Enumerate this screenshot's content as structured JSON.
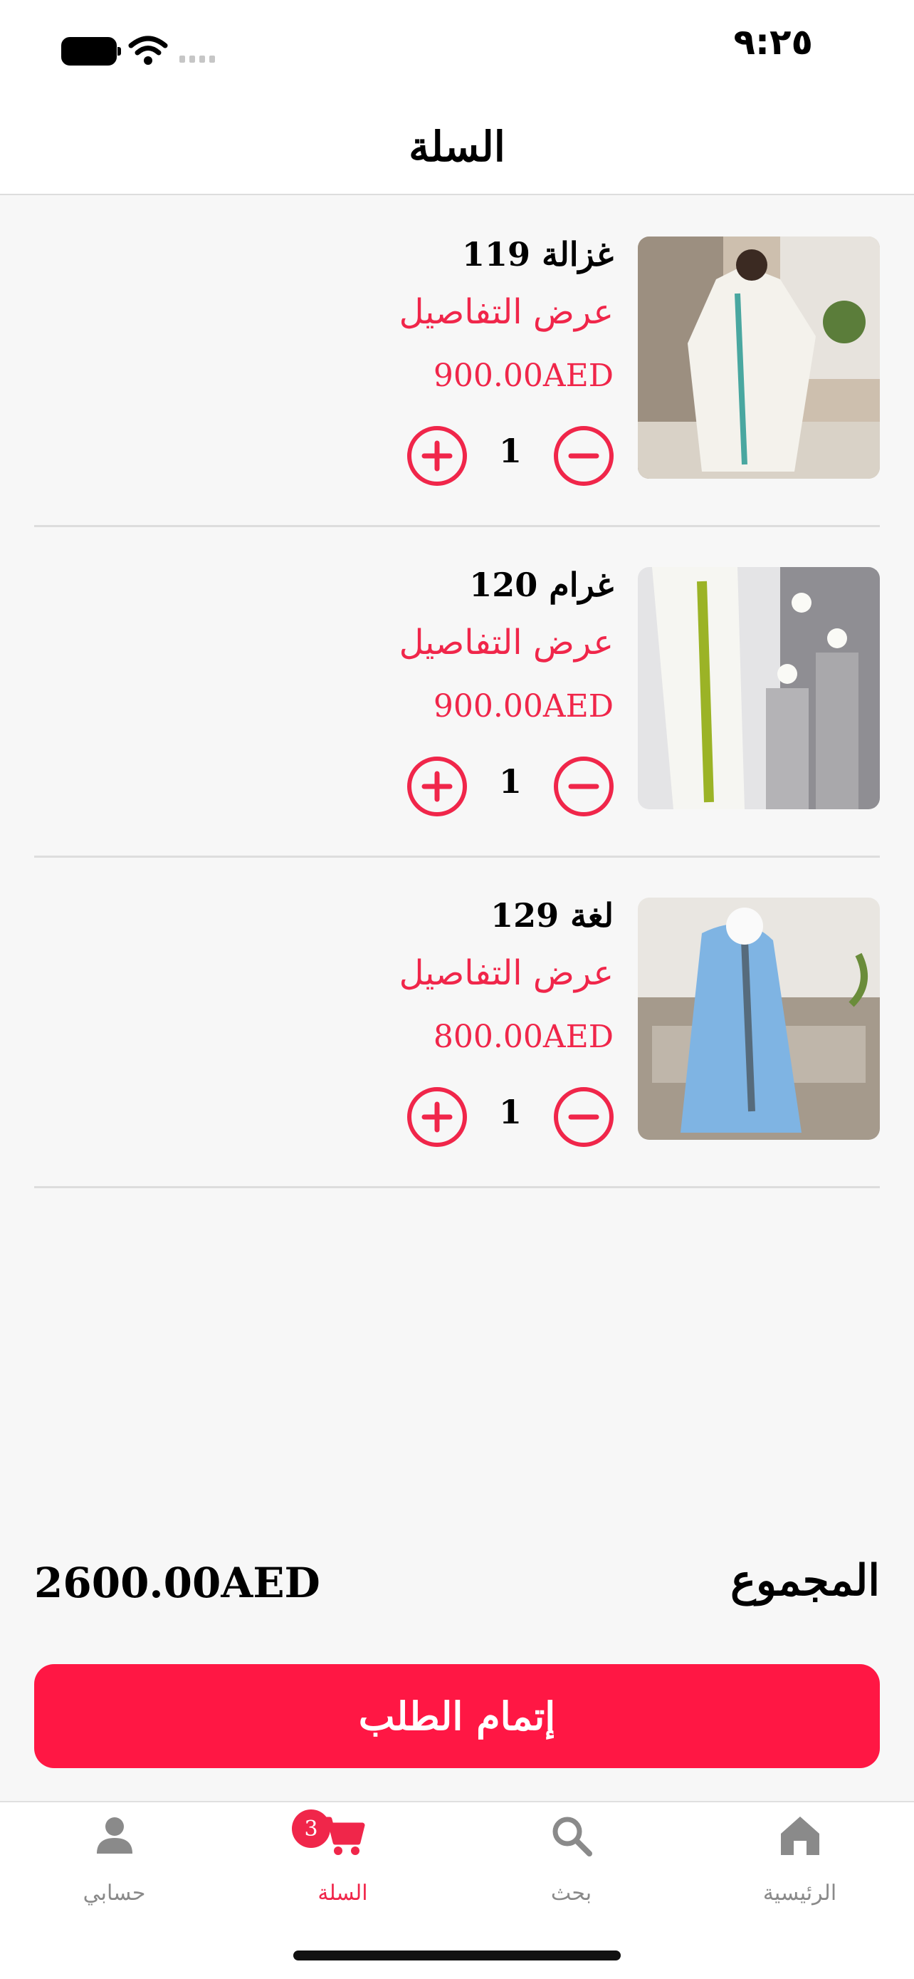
{
  "status": {
    "time": "٩:٢٥"
  },
  "header": {
    "title": "السلة"
  },
  "cart": {
    "items": [
      {
        "name": "غزالة 119",
        "details_label": "عرض التفاصيل",
        "price": "900.00AED",
        "quantity": "1"
      },
      {
        "name": "غرام 120",
        "details_label": "عرض التفاصيل",
        "price": "900.00AED",
        "quantity": "1"
      },
      {
        "name": "لغة 129",
        "details_label": "عرض التفاصيل",
        "price": "800.00AED",
        "quantity": "1"
      }
    ]
  },
  "summary": {
    "total_label": "المجموع",
    "total_amount": "2600.00AED"
  },
  "checkout": {
    "label": "إتمام الطلب"
  },
  "tabs": [
    {
      "label": "حسابي",
      "icon": "person-icon",
      "active": false
    },
    {
      "label": "السلة",
      "icon": "cart-icon",
      "active": true,
      "badge": "3"
    },
    {
      "label": "بحث",
      "icon": "search-icon",
      "active": false
    },
    {
      "label": "الرئيسية",
      "icon": "home-icon",
      "active": false
    }
  ],
  "colors": {
    "accent": "#f0264a",
    "button": "#ff1744",
    "inactive": "#8a8a8a"
  }
}
